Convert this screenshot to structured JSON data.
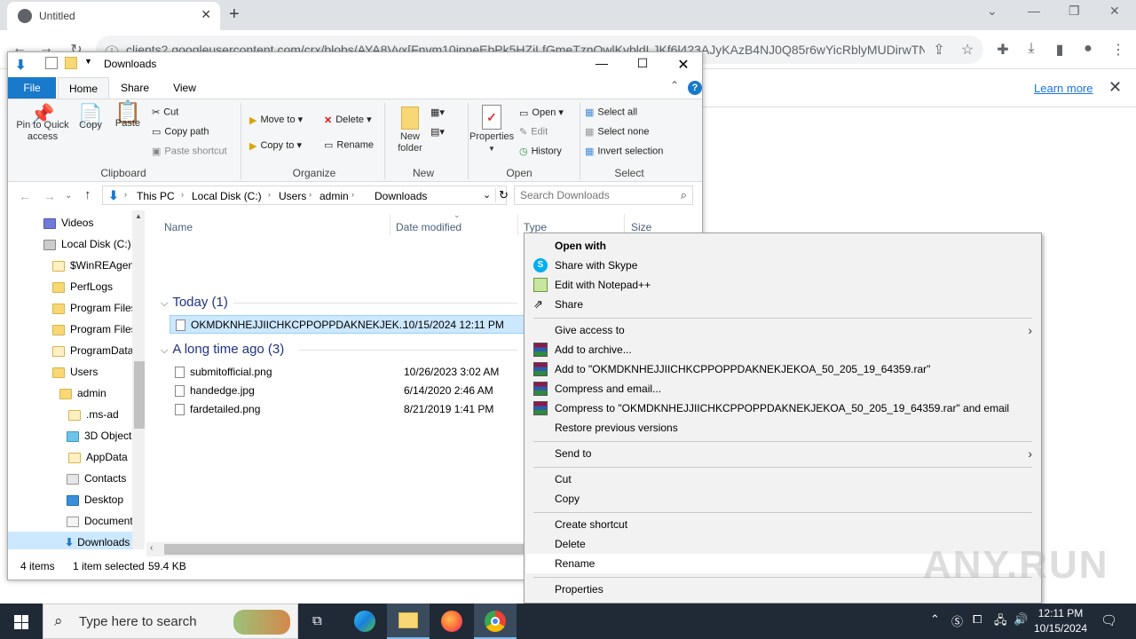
{
  "browser": {
    "tab_title": "Untitled",
    "url": "clients2.googleusercontent.com/crx/blobs/AYA8Vyx[Fnvm10ipneEbPk5HZiLfGmeTznQwlKybldLJKf6l423AJyKAzB4NJ0Q85r6wYicRblyMUDirwTN...",
    "learn_more": "Learn more"
  },
  "explorer": {
    "title": "Downloads",
    "ribbon_tabs": [
      "File",
      "Home",
      "Share",
      "View"
    ],
    "clipboard": {
      "pin_label": "Pin to Quick access",
      "copy_label": "Copy",
      "paste_label": "Paste",
      "cut": "Cut",
      "copy_path": "Copy path",
      "paste_shortcut": "Paste shortcut",
      "group": "Clipboard"
    },
    "organize": {
      "move_to": "Move to",
      "copy_to": "Copy to",
      "delete": "Delete",
      "rename": "Rename",
      "group": "Organize"
    },
    "new": {
      "new_folder": "New folder",
      "group": "New"
    },
    "open": {
      "properties": "Properties",
      "open": "Open",
      "edit": "Edit",
      "history": "History",
      "group": "Open"
    },
    "select": {
      "select_all": "Select all",
      "select_none": "Select none",
      "invert": "Invert selection",
      "group": "Select"
    },
    "breadcrumb": [
      "This PC",
      "Local Disk (C:)",
      "Users",
      "admin",
      "Downloads"
    ],
    "search_placeholder": "Search Downloads",
    "nav_items": [
      "Videos",
      "Local Disk (C:)",
      "$WinREAgent",
      "PerfLogs",
      "Program Files",
      "Program Files",
      "ProgramData",
      "Users",
      "admin",
      ".ms-ad",
      "3D Objects",
      "AppData",
      "Contacts",
      "Desktop",
      "Documents",
      "Downloads"
    ],
    "columns": [
      "Name",
      "Date modified",
      "Type",
      "Size"
    ],
    "groups": [
      {
        "header": "Today (1)",
        "files": [
          {
            "name": "OKMDKNHEJJIICHKCPPOPPDAKNEKJEK...",
            "date": "10/15/2024 12:11 PM"
          }
        ]
      },
      {
        "header": "A long time ago (3)",
        "files": [
          {
            "name": "submitofficial.png",
            "date": "10/26/2023 3:02 AM"
          },
          {
            "name": "handedge.jpg",
            "date": "6/14/2020 2:46 AM"
          },
          {
            "name": "fardetailed.png",
            "date": "8/21/2019 1:41 PM"
          }
        ]
      }
    ],
    "status": {
      "items": "4 items",
      "selected": "1 item selected",
      "size": "59.4 KB"
    }
  },
  "context_menu": {
    "open_with": "Open with",
    "share_skype": "Share with Skype",
    "edit_notepad": "Edit with Notepad++",
    "share": "Share",
    "give_access": "Give access to",
    "add_archive": "Add to archive...",
    "add_rar": "Add to \"OKMDKNHEJJIICHKCPPOPPDAKNEKJEKOA_50_205_19_64359.rar\"",
    "compress_email": "Compress and email...",
    "compress_rar_email": "Compress to \"OKMDKNHEJJIICHKCPPOPPDAKNEKJEKOA_50_205_19_64359.rar\" and email",
    "restore": "Restore previous versions",
    "send_to": "Send to",
    "cut": "Cut",
    "copy": "Copy",
    "create_shortcut": "Create shortcut",
    "delete": "Delete",
    "rename": "Rename",
    "properties": "Properties"
  },
  "taskbar": {
    "search_placeholder": "Type here to search",
    "time": "12:11 PM",
    "date": "10/15/2024"
  },
  "watermark": "ANY.RUN"
}
